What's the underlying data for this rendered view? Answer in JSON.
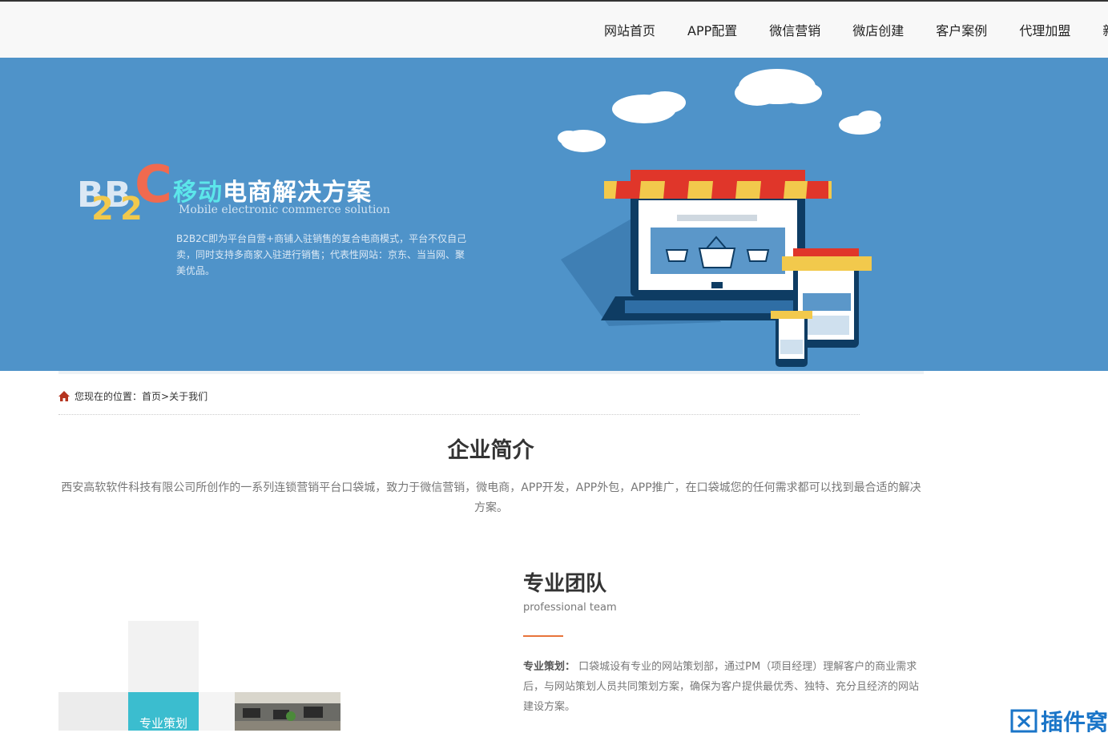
{
  "nav": {
    "items": [
      "网站首页",
      "APP配置",
      "微信营销",
      "微店创建",
      "客户案例",
      "代理加盟",
      "新"
    ]
  },
  "banner": {
    "logo_letters": [
      "B",
      "B",
      "2",
      "2",
      "C"
    ],
    "title_highlight": "移动",
    "title_rest": "电商解决方案",
    "subtitle": "Mobile electronic commerce solution",
    "description": "B2B2C即为平台自营+商铺入驻销售的复合电商模式，平台不仅自己卖，同时支持多商家入驻进行销售；代表性网站：京东、当当网、聚美优品。",
    "colors": {
      "background": "#4f93c9",
      "highlight": "#5ce6ea",
      "logo_c": "#f06a4f",
      "logo_2": "#f2c94c"
    }
  },
  "breadcrumb": {
    "label": "您现在的位置：",
    "home": "首页",
    "separator": ">",
    "current": "关于我们"
  },
  "intro": {
    "title": "企业简介",
    "text": "西安高软软件科技有限公司所创作的一系列连锁营销平台口袋城，致力于微信营销，微电商，APP开发，APP外包，APP推广，在口袋城您的任何需求都可以找到最合适的解决方案。"
  },
  "team": {
    "title": "专业团队",
    "subtitle": "professional team",
    "item_label": "专业策划：",
    "item_text": "口袋城设有专业的网站策划部，通过PM（项目经理）理解客户的商业需求后，与网站策划人员共同策划方案，确保为客户提供最优秀、独特、充分且经济的网站建设方案。",
    "tile_label": "专业策划",
    "accent_color": "#e8743b"
  },
  "watermark": {
    "text": "插件窝"
  }
}
